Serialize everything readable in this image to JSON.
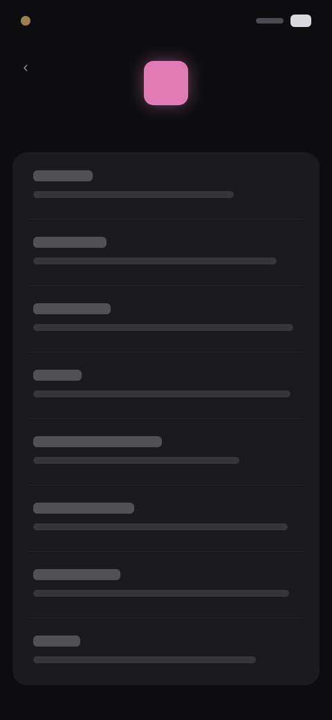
{
  "status_bar": {
    "time": "",
    "icons": [
      "signal-icon",
      "battery-icon"
    ]
  },
  "header": {
    "back_icon": "chevron-left-icon",
    "title": "",
    "accent_color": "#e17bb7"
  },
  "settings_list": {
    "items": [
      {
        "title": "",
        "subtitle": ""
      },
      {
        "title": "",
        "subtitle": ""
      },
      {
        "title": "",
        "subtitle": ""
      },
      {
        "title": "",
        "subtitle": ""
      },
      {
        "title": "",
        "subtitle": ""
      },
      {
        "title": "",
        "subtitle": ""
      },
      {
        "title": "",
        "subtitle": ""
      },
      {
        "title": "",
        "subtitle": ""
      }
    ]
  },
  "colors": {
    "background": "#0d0d0f",
    "card": "#1b1b1e",
    "accent": "#e17bb7"
  }
}
